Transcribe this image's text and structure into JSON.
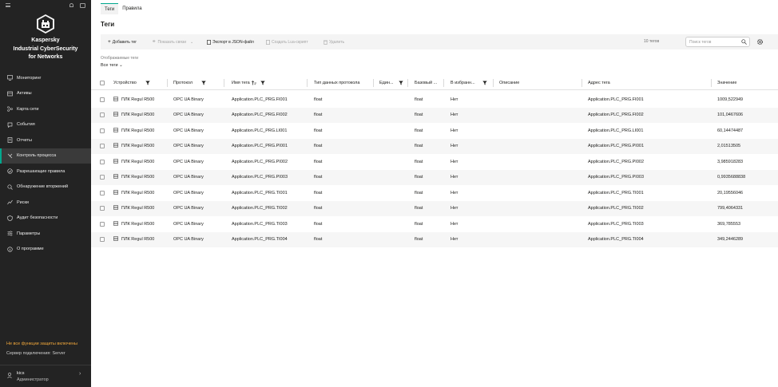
{
  "sidebar": {
    "brand_line1": "Kaspersky",
    "brand_line2": "Industrial CyberSecurity",
    "brand_line3": "for Networks",
    "nav": [
      {
        "label": "Мониторинг",
        "icon": "monitoring-icon",
        "active": false
      },
      {
        "label": "Активы",
        "icon": "assets-icon",
        "active": false
      },
      {
        "label": "Карта сети",
        "icon": "network-map-icon",
        "active": false
      },
      {
        "label": "События",
        "icon": "events-icon",
        "active": false
      },
      {
        "label": "Отчеты",
        "icon": "reports-icon",
        "active": false
      },
      {
        "label": "Контроль процесса",
        "icon": "process-control-icon",
        "active": true
      },
      {
        "label": "Разрешающие правила",
        "icon": "allow-rules-icon",
        "active": false
      },
      {
        "label": "Обнаружение вторжений",
        "icon": "intrusion-detection-icon",
        "active": false
      },
      {
        "label": "Риски",
        "icon": "risks-icon",
        "active": false
      },
      {
        "label": "Аудит безопасности",
        "icon": "security-audit-icon",
        "active": false
      },
      {
        "label": "Параметры",
        "icon": "settings-icon",
        "active": false
      },
      {
        "label": "О программе",
        "icon": "about-icon",
        "active": false
      }
    ],
    "warning": "Не все функции защиты включены",
    "server": "Сервер подключения:  Server",
    "user_name": "kics",
    "user_role": "Администратор"
  },
  "tabs": [
    {
      "label": "Теги",
      "active": true
    },
    {
      "label": "Правила",
      "active": false
    }
  ],
  "page_title": "Теги",
  "toolbar": {
    "add": "Добавить тег",
    "show_links": "Показать связи",
    "export": "Экспорт в JSON-файл",
    "lua": "Создать Lua-скрипт",
    "delete": "Удалить",
    "count": "10 тегов",
    "search_placeholder": "Поиск тегов"
  },
  "filter": {
    "label": "Отображаемые теги",
    "value": "Все теги"
  },
  "columns": {
    "device": "Устройство",
    "protocol": "Протокол",
    "tag_name": "Имя тега",
    "data_type": "Тип данных протокола",
    "unit": "Един...",
    "base_type": "Базовый ...",
    "favorites": "В избранн...",
    "description": "Описание",
    "address": "Адрес тега",
    "value": "Значение"
  },
  "rows": [
    {
      "device": "ПЛК Regul R500",
      "protocol": "OPC UA Binary",
      "tag_name": "Application.PLC_PRG.FI001",
      "data_type": "float",
      "unit": "",
      "base_type": "float",
      "favorites": "Нет",
      "description": "",
      "address": "Application.PLC_PRG.FI001",
      "value": "1009,522949"
    },
    {
      "device": "ПЛК Regul R500",
      "protocol": "OPC UA Binary",
      "tag_name": "Application.PLC_PRG.FI002",
      "data_type": "float",
      "unit": "",
      "base_type": "float",
      "favorites": "Нет",
      "description": "",
      "address": "Application.PLC_PRG.FI002",
      "value": "101,0467606"
    },
    {
      "device": "ПЛК Regul R500",
      "protocol": "OPC UA Binary",
      "tag_name": "Application.PLC_PRG.LI001",
      "data_type": "float",
      "unit": "",
      "base_type": "float",
      "favorites": "Нет",
      "description": "",
      "address": "Application.PLC_PRG.LI001",
      "value": "60,14474487"
    },
    {
      "device": "ПЛК Regul R500",
      "protocol": "OPC UA Binary",
      "tag_name": "Application.PLC_PRG.PI001",
      "data_type": "float",
      "unit": "",
      "base_type": "float",
      "favorites": "Нет",
      "description": "",
      "address": "Application.PLC_PRG.PI001",
      "value": "2,01513505"
    },
    {
      "device": "ПЛК Regul R500",
      "protocol": "OPC UA Binary",
      "tag_name": "Application.PLC_PRG.PI002",
      "data_type": "float",
      "unit": "",
      "base_type": "float",
      "favorites": "Нет",
      "description": "",
      "address": "Application.PLC_PRG.PI002",
      "value": "3,985918283"
    },
    {
      "device": "ПЛК Regul R500",
      "protocol": "OPC UA Binary",
      "tag_name": "Application.PLC_PRG.PI003",
      "data_type": "float",
      "unit": "",
      "base_type": "float",
      "favorites": "Нет",
      "description": "",
      "address": "Application.PLC_PRG.PI003",
      "value": "0,9935688838"
    },
    {
      "device": "ПЛК Regul R500",
      "protocol": "OPC UA Binary",
      "tag_name": "Application.PLC_PRG.TI001",
      "data_type": "float",
      "unit": "",
      "base_type": "float",
      "favorites": "Нет",
      "description": "",
      "address": "Application.PLC_PRG.TI001",
      "value": "20,19556046"
    },
    {
      "device": "ПЛК Regul R500",
      "protocol": "OPC UA Binary",
      "tag_name": "Application.PLC_PRG.TI002",
      "data_type": "float",
      "unit": "",
      "base_type": "float",
      "favorites": "Нет",
      "description": "",
      "address": "Application.PLC_PRG.TI002",
      "value": "799,4064331"
    },
    {
      "device": "ПЛК Regul R500",
      "protocol": "OPC UA Binary",
      "tag_name": "Application.PLC_PRG.TI003",
      "data_type": "float",
      "unit": "",
      "base_type": "float",
      "favorites": "Нет",
      "description": "",
      "address": "Application.PLC_PRG.TI003",
      "value": "369,785553"
    },
    {
      "device": "ПЛК Regul R500",
      "protocol": "OPC UA Binary",
      "tag_name": "Application.PLC_PRG.TI004",
      "data_type": "float",
      "unit": "",
      "base_type": "float",
      "favorites": "Нет",
      "description": "",
      "address": "Application.PLC_PRG.TI004",
      "value": "349,2446289"
    }
  ],
  "colors": {
    "accent": "#00a88e",
    "sidebar_bg": "#232323",
    "warning": "#f2a83b"
  }
}
